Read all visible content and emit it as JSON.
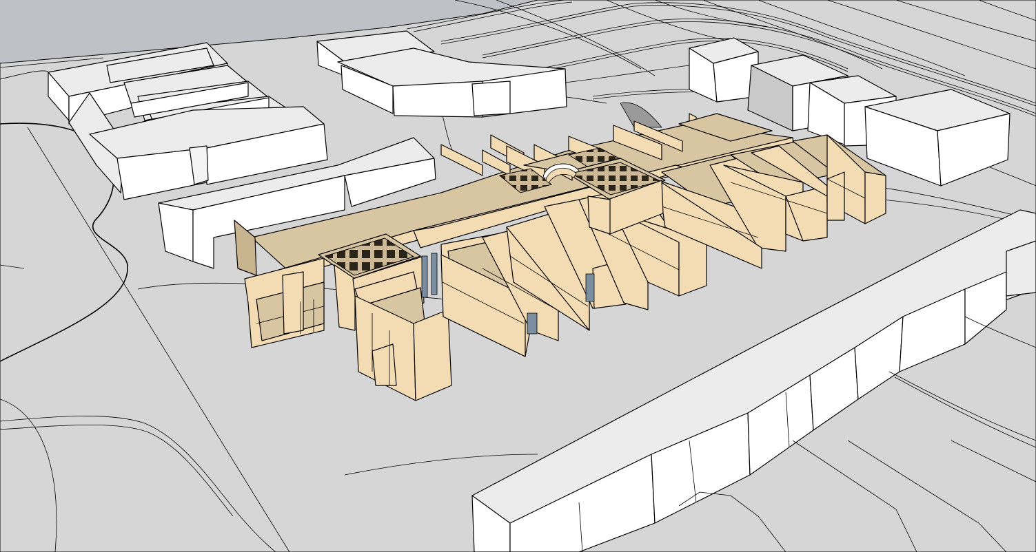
{
  "viewport": {
    "view": "3d-perspective",
    "colors": {
      "sky": "#bfc1c6",
      "ground": "#d6d6d6",
      "building_face_light": "#ffffff",
      "building_face_mid": "#ececec",
      "building_face_shadow": "#c9c9c9",
      "model_wall": "#f3dcb4",
      "model_wall_shadow": "#c9b490",
      "model_floor": "#d8c5a2",
      "edge": "#000000"
    },
    "icons": [
      "grid-roof-icon",
      "skylight-icon"
    ]
  }
}
